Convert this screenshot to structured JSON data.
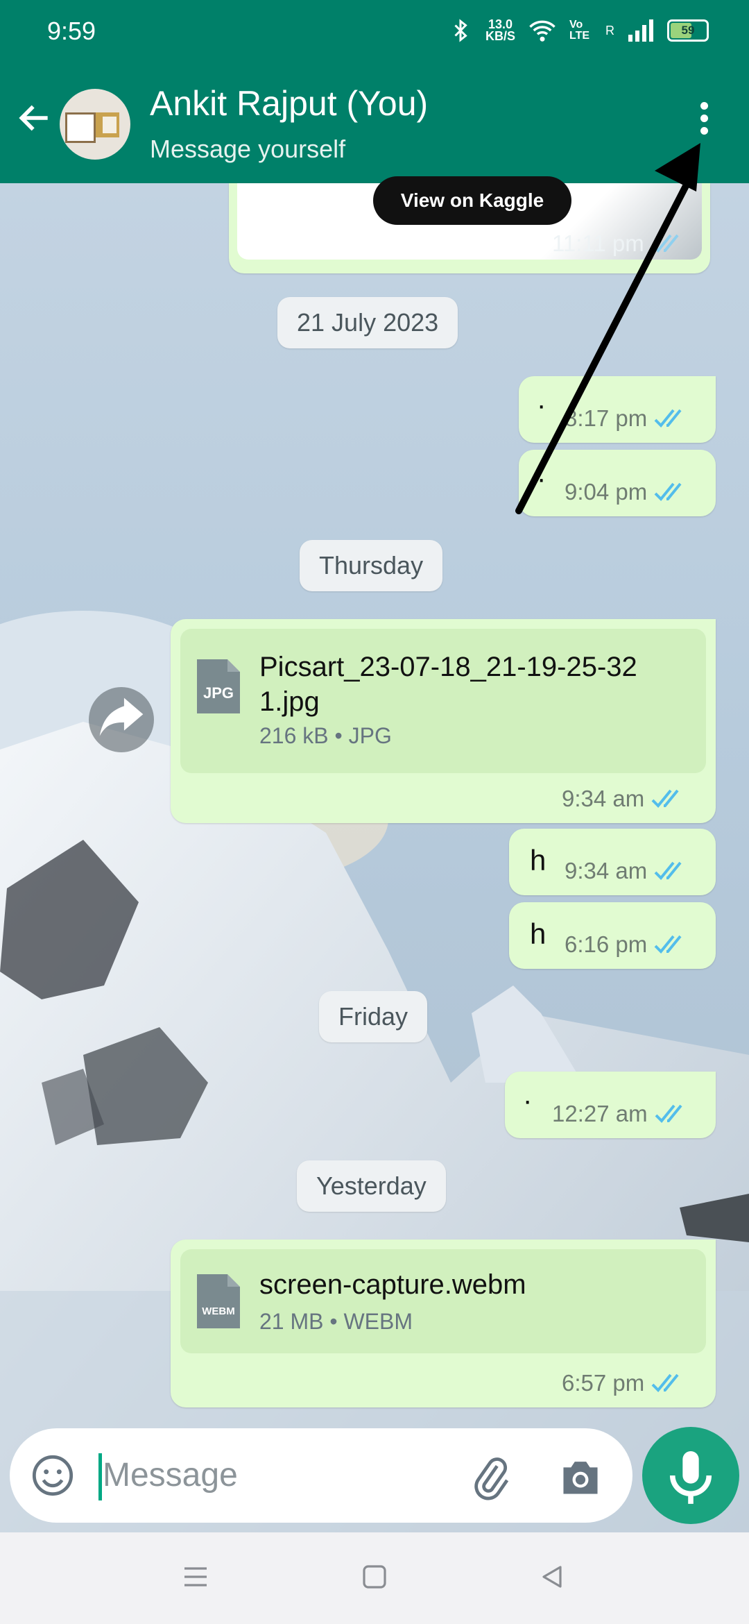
{
  "status_bar": {
    "time": "9:59",
    "net_speed_value": "13.0",
    "net_speed_unit": "KB/S",
    "volte": "Vo LTE",
    "roaming": "R",
    "battery": "59"
  },
  "header": {
    "title": "Ankit Rajput (You)",
    "subtitle": "Message yourself"
  },
  "messages": {
    "kaggle": {
      "button": "View on Kaggle",
      "time": "11:11 pm"
    },
    "date1": "21 July 2023",
    "m1": {
      "text": "·",
      "time": "8:17 pm"
    },
    "m2": {
      "text": "·",
      "time": "9:04 pm"
    },
    "date2": "Thursday",
    "file1": {
      "name_line1": "Picsart_23-07-18_21-19-25-32",
      "name_line2": "1.jpg",
      "info": "216 kB • JPG",
      "ext": "JPG",
      "time": "9:34 am"
    },
    "m3": {
      "text": "h",
      "time": "9:34 am"
    },
    "m4": {
      "text": "h",
      "time": "6:16 pm"
    },
    "date3": "Friday",
    "m5": {
      "text": "·",
      "time": "12:27 am"
    },
    "date4": "Yesterday",
    "file2": {
      "name": "screen-capture.webm",
      "info": "21 MB • WEBM",
      "ext": "WEBM",
      "time": "6:57 pm"
    }
  },
  "composer": {
    "placeholder": "Message"
  },
  "colors": {
    "header": "#008069",
    "bubble": "#e1fbd1",
    "ticks": "#53bdeb",
    "mic": "#1aa37f"
  }
}
